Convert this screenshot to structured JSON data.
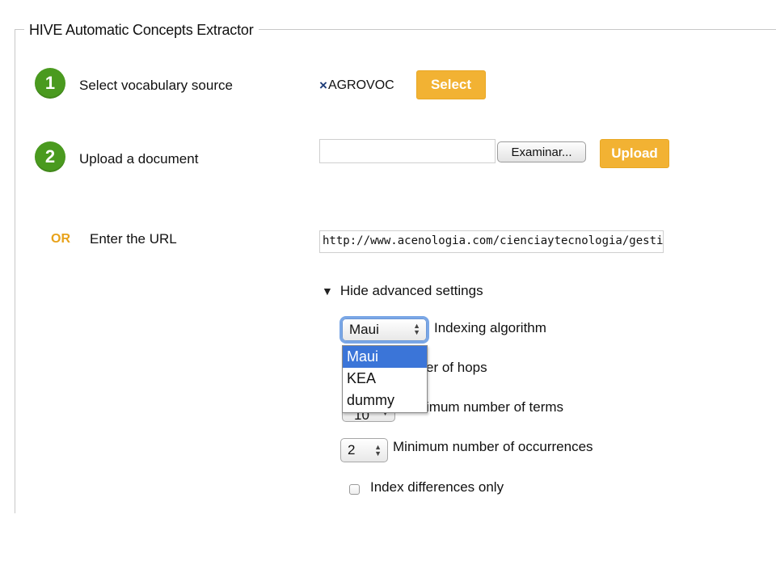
{
  "panel": {
    "legend": "HIVE Automatic Concepts Extractor"
  },
  "step1": {
    "number": "1",
    "label": "Select vocabulary source"
  },
  "vocabulary": {
    "remove_icon": "×",
    "selected": "AGROVOC",
    "select_label": "Select"
  },
  "step2": {
    "number": "2",
    "label": "Upload a document"
  },
  "upload": {
    "file_value": "",
    "browse_label": "Examinar...",
    "upload_label": "Upload"
  },
  "url": {
    "or_label": "OR",
    "label": "Enter the URL",
    "value": "http://www.acenologia.com/cienciaytecnologia/gestion"
  },
  "advanced": {
    "toggle_label": "Hide advanced settings",
    "toggle_icon": "▼",
    "algorithm": {
      "value": "Maui",
      "label": "Indexing algorithm",
      "options": [
        "Maui",
        "KEA",
        "dummy"
      ]
    },
    "hops": {
      "label_visible": "er of hops"
    },
    "min_terms": {
      "value_partial": "10",
      "label_visible": "imum number of terms"
    },
    "min_occurrences": {
      "value": "2",
      "label": "Minimum number of occurrences"
    },
    "diff_only": {
      "label": "Index differences only",
      "checked": false
    }
  },
  "colors": {
    "accent_orange": "#f2b233",
    "step_green": "#4a9a1f",
    "selection_blue": "#3b75d8",
    "or_orange": "#e8a21a"
  }
}
